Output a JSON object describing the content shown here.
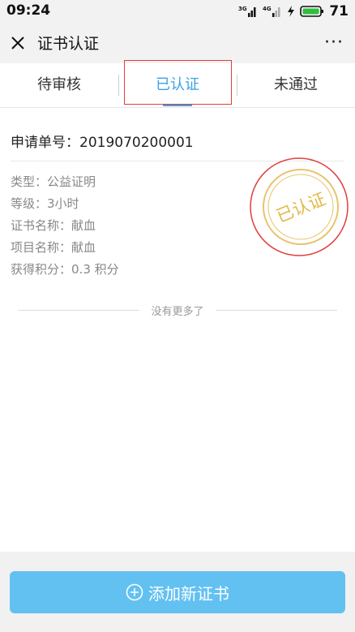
{
  "status_bar": {
    "time": "09:24",
    "battery": "71",
    "signal1_label": "3G",
    "signal2_label": "4G"
  },
  "nav": {
    "title": "证书认证",
    "more": "···"
  },
  "tabs": [
    {
      "label": "待审核"
    },
    {
      "label": "已认证"
    },
    {
      "label": "未通过"
    }
  ],
  "active_tab_index": 1,
  "colors": {
    "accent": "#3aa1e6",
    "stamp": "#e2b84a",
    "highlight": "#e23d3d",
    "button": "#63c1f2"
  },
  "certificate": {
    "order_label": "申请单号：",
    "order_no": "2019070200001",
    "type_label": "类型：",
    "type_value": "公益证明",
    "level_label": "等级：",
    "level_value": "3小时",
    "cert_name_label": "证书名称：",
    "cert_name_value": "献血",
    "project_label": "项目名称：",
    "project_value": "献血",
    "points_label": "获得积分：",
    "points_value": "0.3 积分",
    "stamp_text": "已认证"
  },
  "list_end": "没有更多了",
  "footer": {
    "add_button": "添加新证书",
    "add_icon": "plus-circle-icon"
  }
}
